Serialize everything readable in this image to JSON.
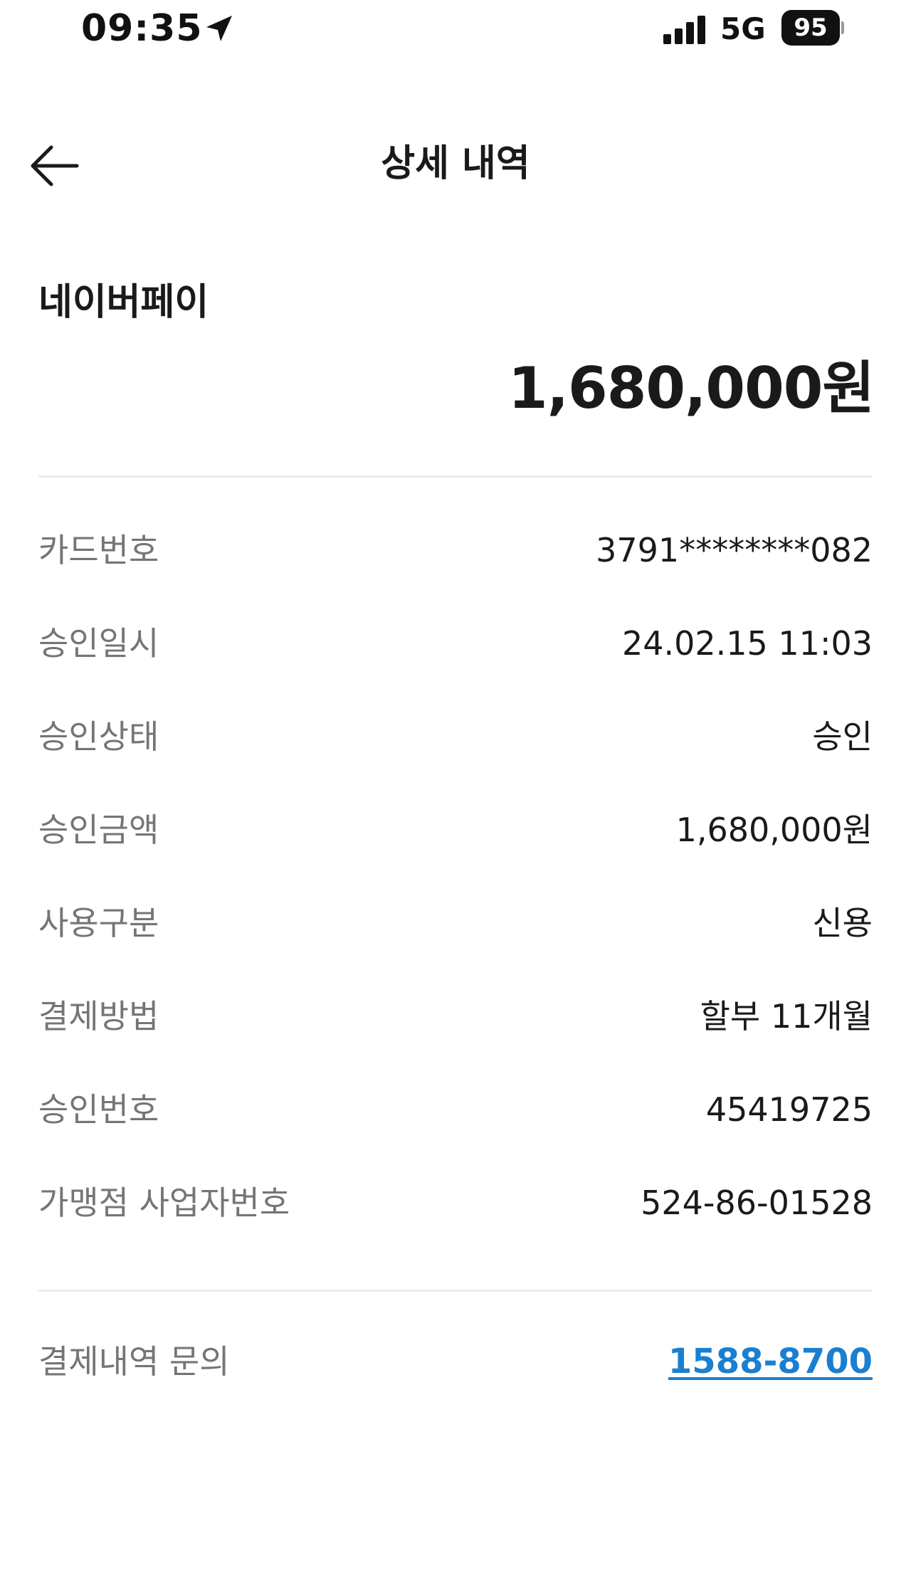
{
  "status_bar": {
    "time": "09:35",
    "network": "5G",
    "battery": "95",
    "icons": [
      "location-arrow-icon",
      "signal-bars-icon",
      "battery-icon"
    ]
  },
  "header": {
    "title": "상세 내역",
    "back_icon": "arrow-left-icon"
  },
  "merchant": {
    "name": "네이버페이",
    "amount": "1,680,000원"
  },
  "details": [
    {
      "label": "카드번호",
      "value": "3791********082"
    },
    {
      "label": "승인일시",
      "value": "24.02.15 11:03"
    },
    {
      "label": "승인상태",
      "value": "승인"
    },
    {
      "label": "승인금액",
      "value": "1,680,000원"
    },
    {
      "label": "사용구분",
      "value": "신용"
    },
    {
      "label": "결제방법",
      "value": "할부 11개월"
    },
    {
      "label": "승인번호",
      "value": "45419725"
    },
    {
      "label": "가맹점 사업자번호",
      "value": "524-86-01528"
    }
  ],
  "inquiry": {
    "label": "결제내역 문의",
    "phone": "1588-8700",
    "link_color": "#1a7fd1"
  }
}
